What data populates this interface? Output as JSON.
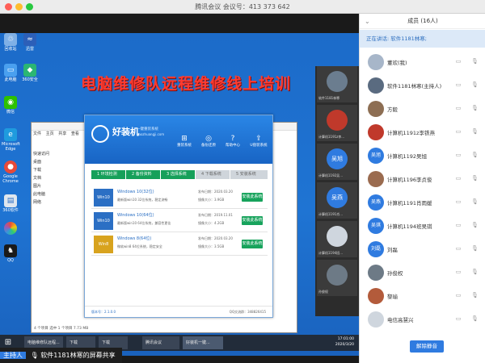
{
  "window": {
    "title": "腾讯会议 会议号：413 373 642"
  },
  "share_bar": {
    "meeting_id": "413 373 642"
  },
  "banner": {
    "text": "电脑维修队远程维修线上培训"
  },
  "installer": {
    "brand": "好装机",
    "subtitle": "一键重装系统",
    "url": "haozhuangji.com",
    "nav": [
      {
        "label": "重装系统",
        "icon": "windows-icon"
      },
      {
        "label": "备份还原",
        "icon": "backup-icon"
      },
      {
        "label": "帮助中心",
        "icon": "help-icon"
      },
      {
        "label": "U盘装系统",
        "icon": "usb-icon"
      }
    ],
    "steps": [
      "1 环境检测",
      "2 备份资料",
      "3 选择系统",
      "4 下载系统",
      "5 安装系统"
    ],
    "systems": [
      {
        "name": "Windows 10(32位)",
        "desc": "最新版win10 32位系统，稳定流畅",
        "date": "发布日期：2020.03.20",
        "size": "镜像大小：3.9GB",
        "button": "安装此系统"
      },
      {
        "name": "Windows 10(64位)",
        "desc": "最新版win10 64位系统，兼容性更佳",
        "date": "发布日期：2019.11.01",
        "size": "镜像大小：4.2GB",
        "button": "安装此系统"
      },
      {
        "name": "Windows 8(64位)",
        "desc": "微软win8 64位系统，稳定安全",
        "date": "发布日期：2020.03.20",
        "size": "镜像大小：3.5GB",
        "button": "安装此系统"
      }
    ],
    "footer_version": "版本号：2.1.0.0",
    "footer_right": "QQ交流群：348826415"
  },
  "explorer": {
    "tabs": [
      "文件",
      "主页",
      "共享",
      "查看"
    ],
    "sidebar": [
      "快速访问",
      "桌面",
      "下载",
      "文档",
      "图片",
      "此电脑",
      "网络"
    ],
    "status": "4 个项目  选中 1 个项目 7.73 MB"
  },
  "desktop_icons": [
    "回收站",
    "迅雷",
    "此电脑",
    "360安全",
    "微信",
    "Microsoft Edge",
    "Google Chrome",
    "360软件",
    "QQ"
  ],
  "taskbar": {
    "items": [
      "电脑维修队远程...",
      "下载",
      "下载",
      "腾讯会议",
      "好装机一键..."
    ],
    "clock_time": "17:01:00",
    "clock_date": "2020/3/20"
  },
  "video_thumbs": [
    {
      "label": "软件1181林寒",
      "avatar_text": ""
    },
    {
      "label": "计算机1191z李...",
      "avatar_text": ""
    },
    {
      "label": "计算机1192吴...",
      "avatar_text": "吴旭"
    },
    {
      "label": "计算机1191肖...",
      "avatar_text": "吴燕"
    },
    {
      "label": "计算机1194班...",
      "avatar_text": ""
    },
    {
      "label": "孙俊权",
      "avatar_text": ""
    }
  ],
  "sharer_tag": {
    "role": "主持人",
    "text": "软件1181林寒的屏幕共享"
  },
  "panel": {
    "title": "成员 (16人)",
    "speaking": "正在讲话: 软件1181林寒;",
    "members": [
      {
        "name": "董欢(我)",
        "avatar_text": "",
        "color": "#a7b6c9"
      },
      {
        "name": "软件1181林寒(主持人)",
        "avatar_text": "",
        "color": "#5a6b80"
      },
      {
        "name": "方毅",
        "avatar_text": "",
        "color": "#8d6e53"
      },
      {
        "name": "计算机1191z李铁燕",
        "avatar_text": "",
        "color": "#c0392b"
      },
      {
        "name": "计算机1192吴旭",
        "avatar_text": "吴旭",
        "color": "#2f7be0"
      },
      {
        "name": "计算机1196李贞俊",
        "avatar_text": "",
        "color": "#9a6b4f"
      },
      {
        "name": "计算机1191肖雨媛",
        "avatar_text": "吴燕",
        "color": "#2f7be0"
      },
      {
        "name": "计算机1194班吴琪",
        "avatar_text": "吴琪",
        "color": "#2f7be0"
      },
      {
        "name": "刘磊",
        "avatar_text": "刘磊",
        "color": "#2f7be0"
      },
      {
        "name": "孙俊权",
        "avatar_text": "",
        "color": "#6d7a86"
      },
      {
        "name": "黎瑜",
        "avatar_text": "",
        "color": "#b35b3b"
      },
      {
        "name": "电信高慧兴",
        "avatar_text": "",
        "color": "#cfd6de"
      }
    ],
    "unmute_button": "解除静音"
  },
  "colors": {
    "accent": "#2f7be0",
    "desktop": "#1f74d3",
    "banner": "#ff3b2f",
    "install_green": "#17a35c"
  }
}
